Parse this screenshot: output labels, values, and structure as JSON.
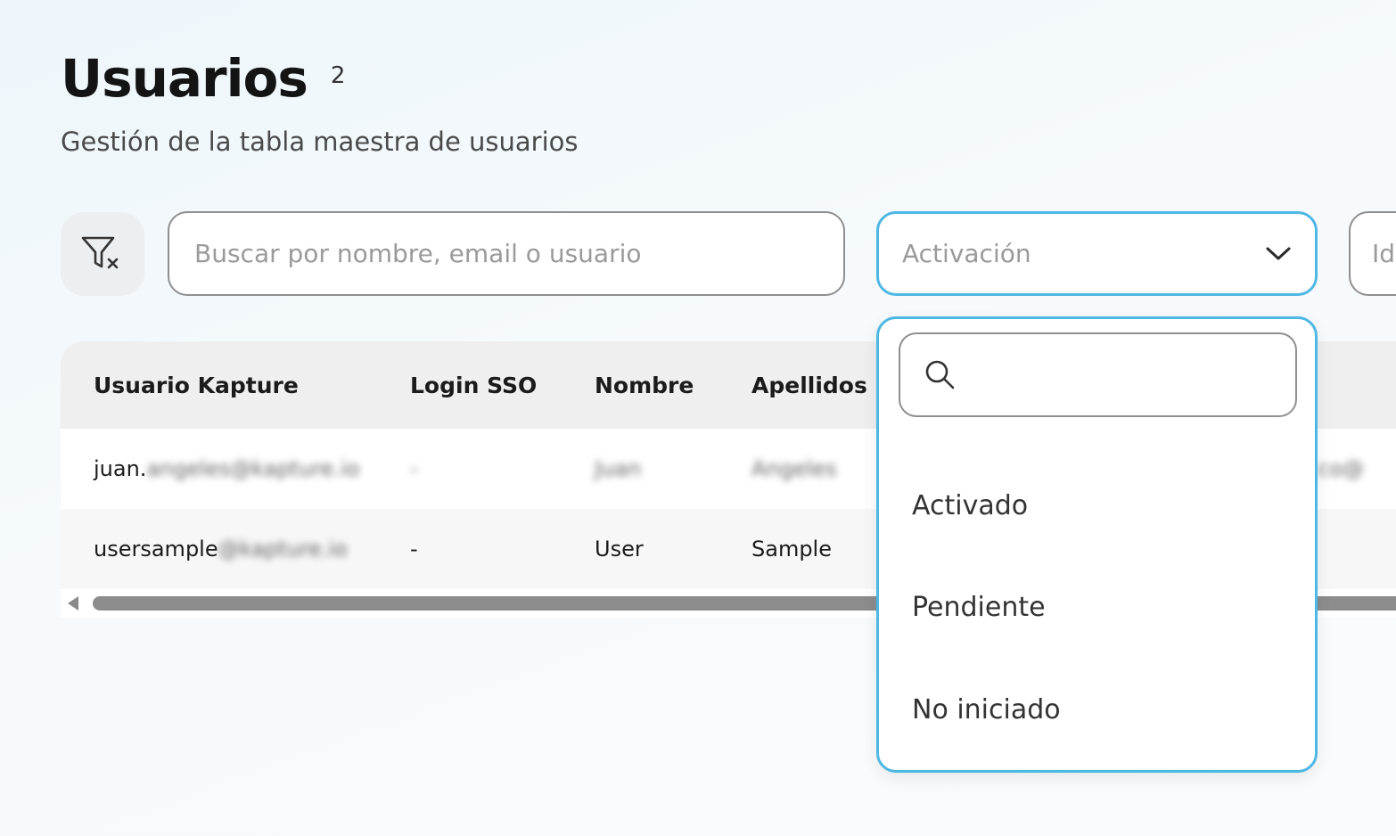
{
  "header": {
    "title": "Usuarios",
    "count": "2",
    "subtitle": "Gestión de la tabla maestra de usuarios"
  },
  "toolbar": {
    "clear_filters_icon": "filter-clear-icon",
    "search_placeholder": "Buscar por nombre, email o usuario",
    "activation_placeholder": "Activación",
    "next_filter_partial": "Id"
  },
  "table": {
    "columns": [
      "Usuario Kapture",
      "Login SSO",
      "Nombre",
      "Apellidos"
    ],
    "rows": [
      {
        "usuario_visible": "juan.",
        "usuario_hidden": "angeles@kapture.io",
        "login": "-",
        "nombre": "Juan",
        "apellidos": "Angeles",
        "edge": "co@"
      },
      {
        "usuario_visible": "usersample",
        "usuario_hidden": "@kapture.io",
        "login": "-",
        "nombre": "User",
        "apellidos": "Sample",
        "edge": ""
      }
    ]
  },
  "dropdown": {
    "search_icon": "search-icon",
    "search_value": "",
    "options": [
      "Activado",
      "Pendiente",
      "No iniciado"
    ]
  },
  "colors": {
    "accent": "#4fb7e4",
    "border": "#8f8f8f",
    "header_bg": "#efefef"
  }
}
